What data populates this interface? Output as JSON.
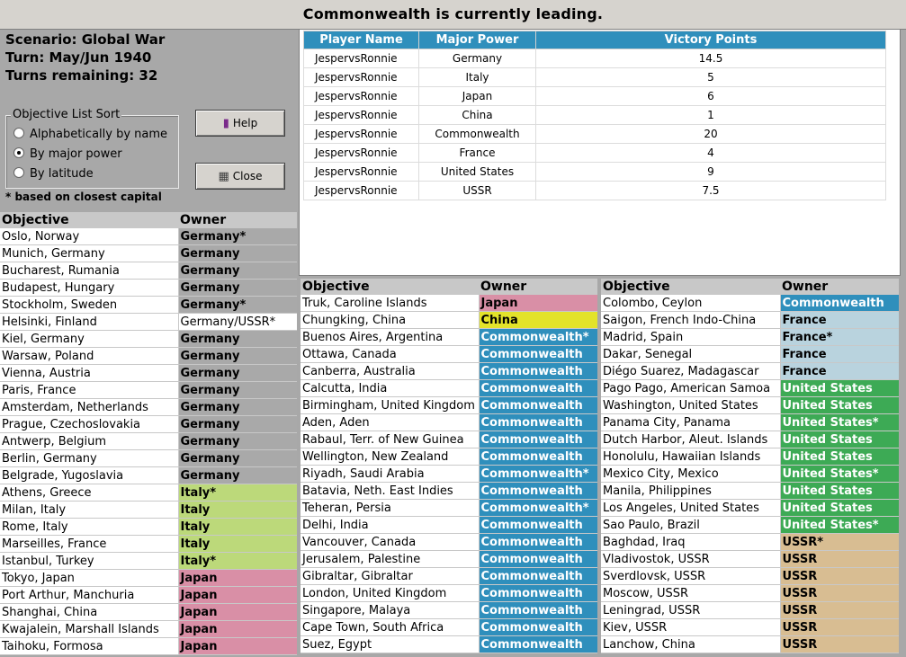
{
  "title": "Commonwealth is currently leading.",
  "scenario": {
    "name": "Scenario: Global War",
    "turn": "Turn: May/Jun 1940",
    "remaining": "Turns remaining: 32"
  },
  "sort": {
    "legend": "Objective List Sort",
    "options": [
      "Alphabetically by name",
      "By major power",
      "By latitude"
    ],
    "selected_index": 1
  },
  "buttons": {
    "help": "Help",
    "close": "Close"
  },
  "note": "* based on closest capital",
  "colors": {
    "Germany": "#a9a9a9",
    "Italy": "#bcd97a",
    "Japan": "#d98fa6",
    "China": "#e3e32a",
    "Commonwealth": "#2f8fbc",
    "France": "#b9d3de",
    "United States": "#3daa55",
    "USSR": "#d8bd92",
    "Mixed": "#ffffff"
  },
  "victory_table": {
    "headers": [
      "Player Name",
      "Major Power",
      "Victory Points"
    ],
    "rows": [
      [
        "JespervsRonnie",
        "Germany",
        "14.5"
      ],
      [
        "JespervsRonnie",
        "Italy",
        "5"
      ],
      [
        "JespervsRonnie",
        "Japan",
        "6"
      ],
      [
        "JespervsRonnie",
        "China",
        "1"
      ],
      [
        "JespervsRonnie",
        "Commonwealth",
        "20"
      ],
      [
        "JespervsRonnie",
        "France",
        "4"
      ],
      [
        "JespervsRonnie",
        "United States",
        "9"
      ],
      [
        "JespervsRonnie",
        "USSR",
        "7.5"
      ]
    ]
  },
  "objective_headers": {
    "objective": "Objective",
    "owner": "Owner"
  },
  "objectives_left": [
    {
      "name": "Oslo, Norway",
      "owner": "Germany*",
      "power": "Germany"
    },
    {
      "name": "Munich, Germany",
      "owner": "Germany",
      "power": "Germany"
    },
    {
      "name": "Bucharest, Rumania",
      "owner": "Germany",
      "power": "Germany"
    },
    {
      "name": "Budapest, Hungary",
      "owner": "Germany",
      "power": "Germany"
    },
    {
      "name": "Stockholm, Sweden",
      "owner": "Germany*",
      "power": "Germany"
    },
    {
      "name": "Helsinki, Finland",
      "owner": "Germany/USSR*",
      "power": "Mixed"
    },
    {
      "name": "Kiel, Germany",
      "owner": "Germany",
      "power": "Germany"
    },
    {
      "name": "Warsaw, Poland",
      "owner": "Germany",
      "power": "Germany"
    },
    {
      "name": "Vienna, Austria",
      "owner": "Germany",
      "power": "Germany"
    },
    {
      "name": "Paris, France",
      "owner": "Germany",
      "power": "Germany"
    },
    {
      "name": "Amsterdam, Netherlands",
      "owner": "Germany",
      "power": "Germany"
    },
    {
      "name": "Prague, Czechoslovakia",
      "owner": "Germany",
      "power": "Germany"
    },
    {
      "name": "Antwerp, Belgium",
      "owner": "Germany",
      "power": "Germany"
    },
    {
      "name": "Berlin, Germany",
      "owner": "Germany",
      "power": "Germany"
    },
    {
      "name": "Belgrade, Yugoslavia",
      "owner": "Germany",
      "power": "Germany"
    },
    {
      "name": "Athens, Greece",
      "owner": "Italy*",
      "power": "Italy"
    },
    {
      "name": "Milan, Italy",
      "owner": "Italy",
      "power": "Italy"
    },
    {
      "name": "Rome, Italy",
      "owner": "Italy",
      "power": "Italy"
    },
    {
      "name": "Marseilles, France",
      "owner": "Italy",
      "power": "Italy"
    },
    {
      "name": "Istanbul, Turkey",
      "owner": "Italy*",
      "power": "Italy"
    },
    {
      "name": "Tokyo, Japan",
      "owner": "Japan",
      "power": "Japan"
    },
    {
      "name": "Port Arthur, Manchuria",
      "owner": "Japan",
      "power": "Japan"
    },
    {
      "name": "Shanghai, China",
      "owner": "Japan",
      "power": "Japan"
    },
    {
      "name": "Kwajalein, Marshall Islands",
      "owner": "Japan",
      "power": "Japan"
    },
    {
      "name": "Taihoku, Formosa",
      "owner": "Japan",
      "power": "Japan"
    }
  ],
  "objectives_mid": [
    {
      "name": "Truk, Caroline Islands",
      "owner": "Japan",
      "power": "Japan"
    },
    {
      "name": "Chungking, China",
      "owner": "China",
      "power": "China"
    },
    {
      "name": "Buenos Aires, Argentina",
      "owner": "Commonwealth*",
      "power": "Commonwealth"
    },
    {
      "name": "Ottawa, Canada",
      "owner": "Commonwealth",
      "power": "Commonwealth"
    },
    {
      "name": "Canberra, Australia",
      "owner": "Commonwealth",
      "power": "Commonwealth"
    },
    {
      "name": "Calcutta, India",
      "owner": "Commonwealth",
      "power": "Commonwealth"
    },
    {
      "name": "Birmingham, United Kingdom",
      "owner": "Commonwealth",
      "power": "Commonwealth"
    },
    {
      "name": "Aden, Aden",
      "owner": "Commonwealth",
      "power": "Commonwealth"
    },
    {
      "name": "Rabaul, Terr. of New Guinea",
      "owner": "Commonwealth",
      "power": "Commonwealth"
    },
    {
      "name": "Wellington, New Zealand",
      "owner": "Commonwealth",
      "power": "Commonwealth"
    },
    {
      "name": "Riyadh, Saudi Arabia",
      "owner": "Commonwealth*",
      "power": "Commonwealth"
    },
    {
      "name": "Batavia, Neth. East Indies",
      "owner": "Commonwealth",
      "power": "Commonwealth"
    },
    {
      "name": "Teheran, Persia",
      "owner": "Commonwealth*",
      "power": "Commonwealth"
    },
    {
      "name": "Delhi, India",
      "owner": "Commonwealth",
      "power": "Commonwealth"
    },
    {
      "name": "Vancouver, Canada",
      "owner": "Commonwealth",
      "power": "Commonwealth"
    },
    {
      "name": "Jerusalem, Palestine",
      "owner": "Commonwealth",
      "power": "Commonwealth"
    },
    {
      "name": "Gibraltar, Gibraltar",
      "owner": "Commonwealth",
      "power": "Commonwealth"
    },
    {
      "name": "London, United Kingdom",
      "owner": "Commonwealth",
      "power": "Commonwealth"
    },
    {
      "name": "Singapore, Malaya",
      "owner": "Commonwealth",
      "power": "Commonwealth"
    },
    {
      "name": "Cape Town, South Africa",
      "owner": "Commonwealth",
      "power": "Commonwealth"
    },
    {
      "name": "Suez, Egypt",
      "owner": "Commonwealth",
      "power": "Commonwealth"
    }
  ],
  "objectives_right": [
    {
      "name": "Colombo, Ceylon",
      "owner": "Commonwealth",
      "power": "Commonwealth"
    },
    {
      "name": "Saigon, French Indo-China",
      "owner": "France",
      "power": "France"
    },
    {
      "name": "Madrid, Spain",
      "owner": "France*",
      "power": "France"
    },
    {
      "name": "Dakar, Senegal",
      "owner": "France",
      "power": "France"
    },
    {
      "name": "Diégo Suarez, Madagascar",
      "owner": "France",
      "power": "France"
    },
    {
      "name": "Pago Pago, American Samoa",
      "owner": "United States",
      "power": "United States"
    },
    {
      "name": "Washington, United States",
      "owner": "United States",
      "power": "United States"
    },
    {
      "name": "Panama City, Panama",
      "owner": "United States*",
      "power": "United States"
    },
    {
      "name": "Dutch Harbor, Aleut. Islands",
      "owner": "United States",
      "power": "United States"
    },
    {
      "name": "Honolulu, Hawaiian Islands",
      "owner": "United States",
      "power": "United States"
    },
    {
      "name": "Mexico City, Mexico",
      "owner": "United States*",
      "power": "United States"
    },
    {
      "name": "Manila, Philippines",
      "owner": "United States",
      "power": "United States"
    },
    {
      "name": "Los Angeles, United States",
      "owner": "United States",
      "power": "United States"
    },
    {
      "name": "Sao Paulo, Brazil",
      "owner": "United States*",
      "power": "United States"
    },
    {
      "name": "Baghdad, Iraq",
      "owner": "USSR*",
      "power": "USSR"
    },
    {
      "name": "Vladivostok, USSR",
      "owner": "USSR",
      "power": "USSR"
    },
    {
      "name": "Sverdlovsk, USSR",
      "owner": "USSR",
      "power": "USSR"
    },
    {
      "name": "Moscow, USSR",
      "owner": "USSR",
      "power": "USSR"
    },
    {
      "name": "Leningrad, USSR",
      "owner": "USSR",
      "power": "USSR"
    },
    {
      "name": "Kiev, USSR",
      "owner": "USSR",
      "power": "USSR"
    },
    {
      "name": "Lanchow, China",
      "owner": "USSR",
      "power": "USSR"
    }
  ]
}
